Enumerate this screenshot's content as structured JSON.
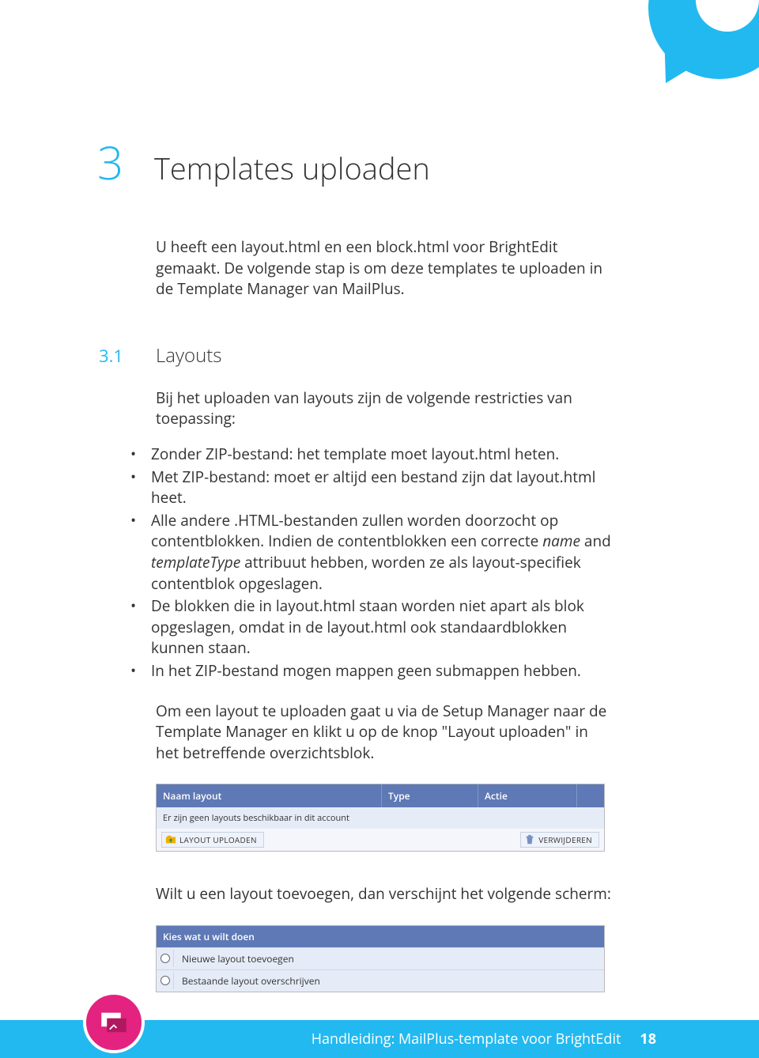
{
  "chapter": {
    "number": "3",
    "title": "Templates uploaden"
  },
  "intro": "U heeft een layout.html en een block.html voor BrightEdit gemaakt. De volgende stap is om deze templates te uploaden in de Template Manager van MailPlus.",
  "section": {
    "number": "3.1",
    "title": "Layouts"
  },
  "restrictions_intro": "Bij het uploaden van layouts zijn de volgende restricties van toepassing:",
  "bullets": {
    "b1": "Zonder ZIP-bestand: het template moet layout.html heten.",
    "b2": "Met ZIP-bestand: moet er altijd een bestand zijn dat layout.html heet.",
    "b3a": "Alle andere .HTML-bestanden zullen worden doorzocht op contentblokken. Indien de contentblokken een correcte ",
    "b3_name": "name",
    "b3b": " and ",
    "b3_templateType": "templateType",
    "b3c": " attribuut hebben, worden ze als layout-specifiek contentblok opgeslagen.",
    "b4": "De blokken die in layout.html staan worden niet apart als blok opgeslagen, omdat in de layout.html ook standaardblokken kunnen staan.",
    "b5": "In het ZIP-bestand mogen mappen geen submappen hebben."
  },
  "upload_para": "Om een layout te uploaden gaat u via de Setup Manager naar de Template Manager en klikt u op de knop \"Layout uploaden\" in het betreffende overzichtsblok.",
  "panel1": {
    "header": {
      "c1": "Naam layout",
      "c2": "Type",
      "c3": "Actie"
    },
    "empty_msg": "Er zijn geen layouts beschikbaar in dit account",
    "btn_upload": "LAYOUT UPLOADEN",
    "btn_delete": "VERWIJDEREN"
  },
  "add_para": "Wilt u een layout toevoegen, dan verschijnt het volgende scherm:",
  "panel2": {
    "header": "Kies wat u wilt doen",
    "opt1": "Nieuwe layout toevoegen",
    "opt2": "Bestaande layout overschrijven"
  },
  "footer": {
    "doc": "Handleiding: MailPlus-template voor BrightEdit",
    "page": "18"
  }
}
